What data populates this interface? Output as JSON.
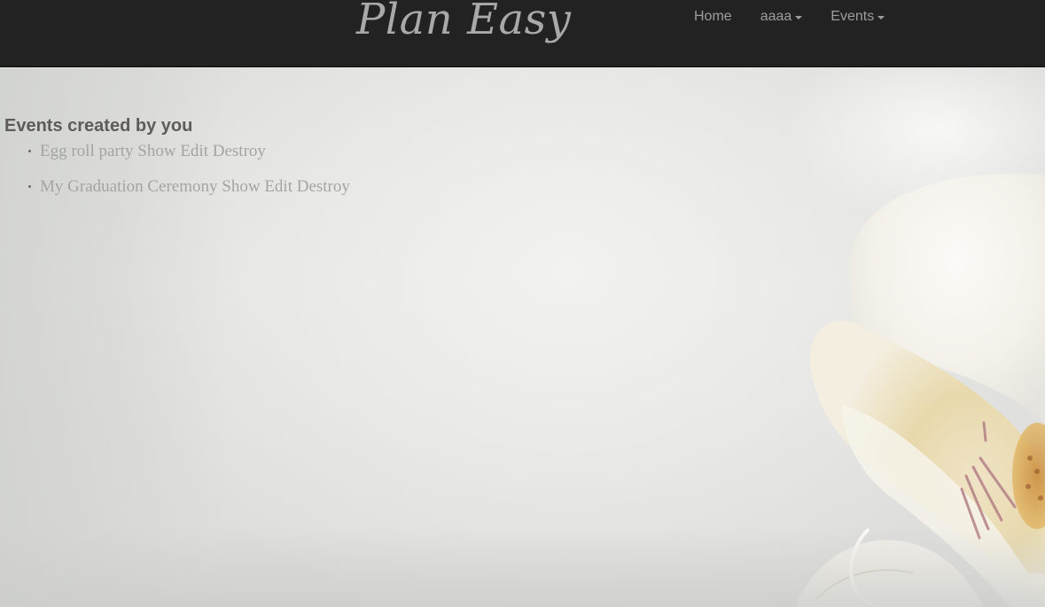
{
  "brand": "Plan Easy",
  "nav": {
    "home": "Home",
    "user_menu": "aaaa",
    "events_menu": "Events"
  },
  "content": {
    "heading": "Events created by you",
    "events": [
      {
        "name": "Egg roll party",
        "show": "Show",
        "edit": "Edit",
        "destroy": "Destroy"
      },
      {
        "name": "My Graduation Ceremony",
        "show": "Show",
        "edit": "Edit",
        "destroy": "Destroy"
      }
    ]
  },
  "colors": {
    "navbar_bg": "#222222",
    "nav_text": "#9d9d9d",
    "heading_text": "#5d5c58",
    "link_text": "#a4a4a2"
  },
  "icons": {
    "caret": "caret-down-icon",
    "background": "orchid-background-image"
  }
}
